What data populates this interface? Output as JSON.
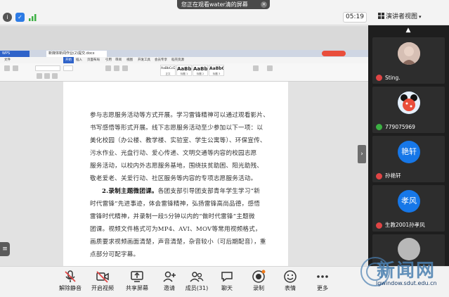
{
  "topbar": {
    "sharing_notice": "您正在观看water清的屏幕",
    "timer": "05:19",
    "presenter_view": "演讲者视图"
  },
  "document_window": {
    "app_tab": "WPS",
    "file_tab": "新媒体新闻作业(2)提交.docx",
    "ribbon_tabs": [
      "文件",
      "开始",
      "插入",
      "页面布局",
      "引用",
      "审阅",
      "视图",
      "开发工具",
      "会员专享",
      "稻壳资源"
    ],
    "styles": [
      {
        "sample": "AaBbCcDd",
        "name": "正文"
      },
      {
        "sample": "AaBb",
        "name": "标题 1"
      },
      {
        "sample": "AaBb",
        "name": "标题 2"
      },
      {
        "sample": "AaBbC",
        "name": "标题 3"
      }
    ],
    "lines": [
      "参与志愿服务活动等方式开展。学习雷锋精神可以通过观看影片、",
      "书写感悟等形式开展。线下志愿服务活动至少参加以下一项：以",
      "美化校园（办公楼、教学楼、实验室、学生公寓等）、环保宣传、",
      "污水作业、光盘行动、爱心传递、文明交通等内容的校园志愿",
      "服务活动，以校内外志愿服务基地，围绕扶贫助困、阳光助残、",
      "敬老爱老、关爱行动、社区服务等内容的专项志愿服务活动。"
    ],
    "bold_lead": "2.录制主题微团课。",
    "lines2": [
      "各团支部引导团支部青年学生学习“新",
      "时代雷锋”先进事迹，体会雷锋精神，弘扬雷锋高尚品德，感悟",
      "雷锋时代精神，并录制一段5分钟以内的“做时代雷锋”主题微",
      "团课。视频文件格式可为MP4、AVI、MOV等常用视频格式，",
      "画质要求视频画面清楚，声音清楚，杂音较小（可后期配音），重",
      "点部分可配字幕。"
    ],
    "status_left": "页面：2/3  节：1/1  设置值：2.7厘米  行：4  列：1  字数：2134  拼写检查",
    "zoom": "- 120% +",
    "search_placeholder": "在这里输入你要搜索的内容"
  },
  "participants": [
    {
      "name": "Sting.",
      "avatar_text": "",
      "mic": "muted",
      "avatar_color": "#c9a79a"
    },
    {
      "name": "779075969",
      "avatar_text": "",
      "mic": "on",
      "avatar_color": "#1a5fa8"
    },
    {
      "name": "孙艳轩",
      "avatar_text": "艳轩",
      "mic": "muted",
      "avatar_color": "#1677e8"
    },
    {
      "name": "生教2001孙孝风",
      "avatar_text": "孝风",
      "mic": "muted",
      "avatar_color": "#1677e8"
    },
    {
      "name": "",
      "avatar_text": "",
      "mic": "none",
      "avatar_color": "#b8b8b8"
    }
  ],
  "toolbar": {
    "unmute": "解除静音",
    "video": "开启视频",
    "share": "共享屏幕",
    "invite": "邀请",
    "members": "成员(31)",
    "chat": "聊天",
    "record": "录制",
    "reactions": "表情",
    "more": "更多"
  },
  "watermark": {
    "text": "新闻网",
    "url": "lgwindow.sdut.edu.cn"
  }
}
